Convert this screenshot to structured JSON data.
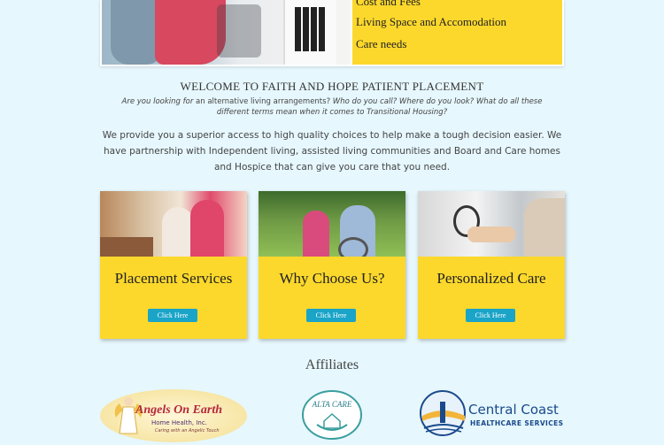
{
  "hero": {
    "menu_items": [
      "Cost and Fees",
      "Living Space and Accomodation",
      "Care needs"
    ]
  },
  "welcome": {
    "title": "WELCOME TO FAITH AND HOPE PATIENT PLACEMENT",
    "subtitle_prefix": "Are you looking for",
    "subtitle_mid": "an alternative living arrangements?",
    "subtitle_rest": "Who do you call? Where do you look? What do all these different terms mean when it comes to Transitional Housing?",
    "body": "We provide you a superior access to high quality choices to help make a tough decision easier. We have partnership with Independent living, assisted living communities and Board and Care homes and Hospice that can give you care that you need."
  },
  "cards": [
    {
      "title": "Placement Services",
      "button": "Click Here"
    },
    {
      "title": "Why Choose Us?",
      "button": "Click Here"
    },
    {
      "title": "Personalized Care",
      "button": "Click Here"
    }
  ],
  "affiliates": {
    "title": "Affiliates",
    "angels": {
      "name": "Angels On Earth",
      "line2": "Home Health, Inc.",
      "line3": "Caring with an Angelic Touch"
    },
    "alta": {
      "name": "ALTA CARE"
    },
    "central_coast": {
      "name": "Central Coast",
      "sub": "HEALTHCARE SERVICES"
    }
  },
  "colors": {
    "accent": "#fcd82c",
    "button": "#1aa4c8",
    "background": "#e6f7fd"
  }
}
